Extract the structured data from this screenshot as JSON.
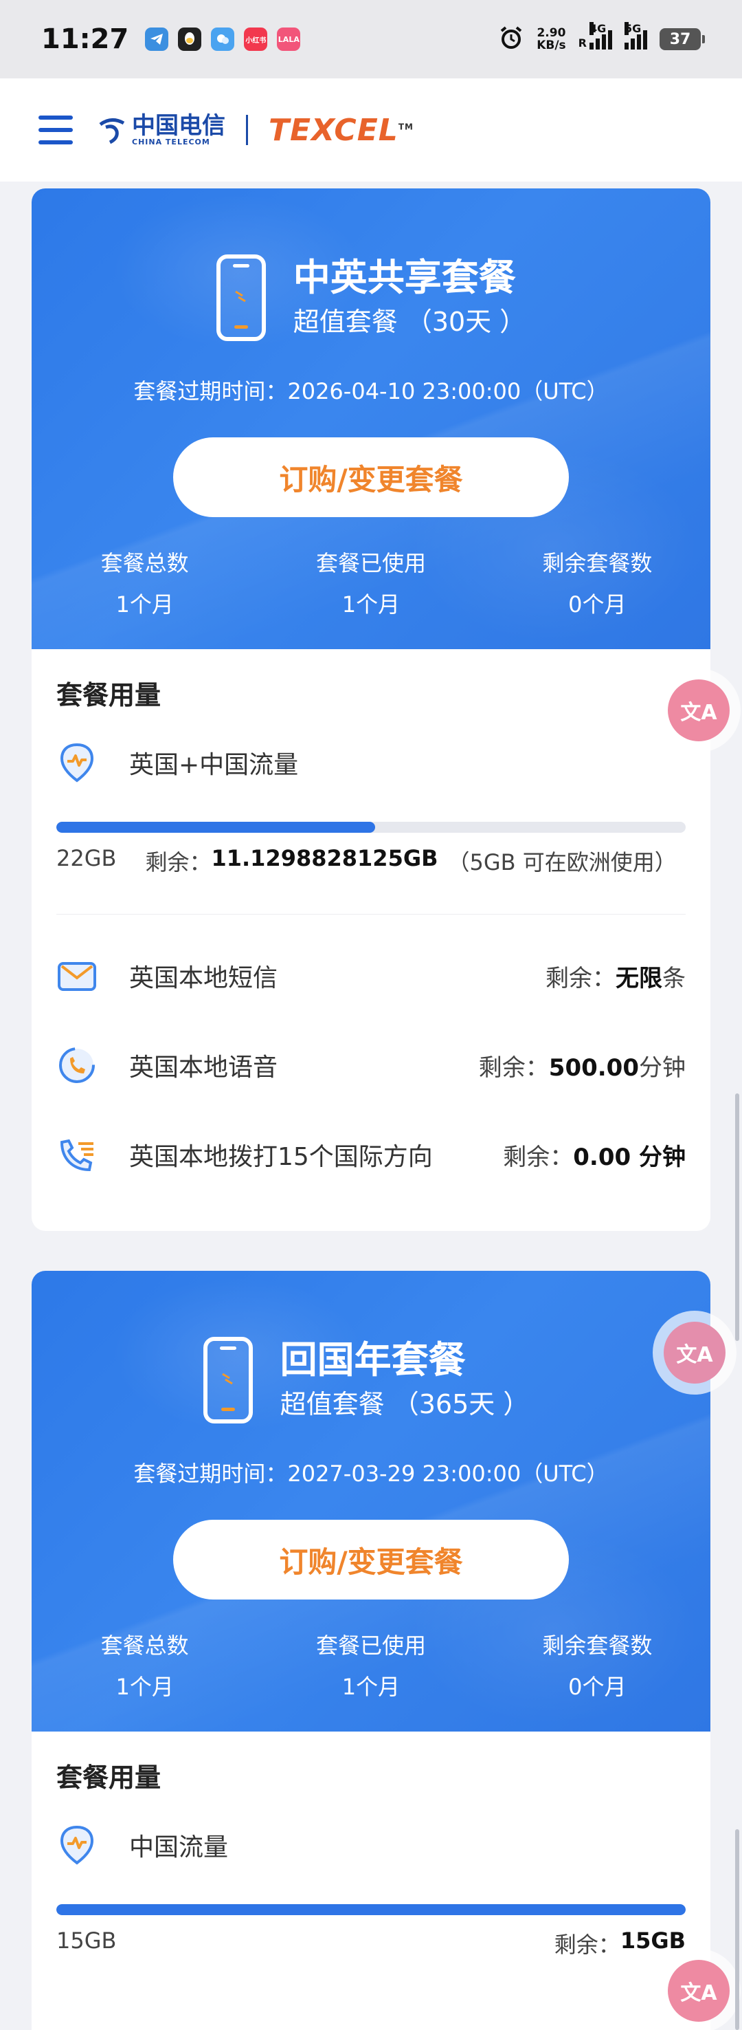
{
  "status_bar": {
    "time": "11:27",
    "net_speed_value": "2.90",
    "net_speed_unit": "KB/s",
    "net_r": "R",
    "sig1_label": "4G",
    "sig2_label": "5G",
    "battery": "37",
    "notif_label": "小红书",
    "notif_label2": "LALA"
  },
  "header": {
    "brand_cn": "中国电信",
    "brand_en": "CHINA TELECOM",
    "partner": "TEXCEL",
    "partner_tm": "TM"
  },
  "plans": [
    {
      "name": "中英共享套餐",
      "subtitle": "超值套餐 （30天 ）",
      "expire": "套餐过期时间：2026-04-10 23:00:00（UTC）",
      "order_button": "订购/变更套餐",
      "stats": [
        {
          "label": "套餐总数",
          "value": "1个月"
        },
        {
          "label": "套餐已使用",
          "value": "1个月"
        },
        {
          "label": "剩余套餐数",
          "value": "0个月"
        }
      ],
      "usage_title": "套餐用量",
      "data": {
        "label": "英国+中国流量",
        "progress_fraction": 0.507,
        "total": "22GB",
        "remain_prefix": "剩余：",
        "remain_value": "11.1298828125GB",
        "note": "（5GB 可在欧洲使用）"
      },
      "services": [
        {
          "label": "英国本地短信",
          "remain_prefix": "剩余：",
          "remain_value": "无限",
          "remain_unit": "条"
        },
        {
          "label": "英国本地语音",
          "remain_prefix": "剩余：",
          "remain_value": "500.00",
          "remain_unit": "分钟"
        },
        {
          "label": "英国本地拨打15个国际方向",
          "remain_prefix": "剩余：",
          "remain_value": "0.00",
          "remain_unit": " 分钟"
        }
      ]
    },
    {
      "name": "回国年套餐",
      "subtitle": "超值套餐 （365天 ）",
      "expire": "套餐过期时间：2027-03-29 23:00:00（UTC）",
      "order_button": "订购/变更套餐",
      "stats": [
        {
          "label": "套餐总数",
          "value": "1个月"
        },
        {
          "label": "套餐已使用",
          "value": "1个月"
        },
        {
          "label": "剩余套餐数",
          "value": "0个月"
        }
      ],
      "usage_title": "套餐用量",
      "data": {
        "label": "中国流量",
        "progress_fraction": 1.0,
        "total": "15GB",
        "remain_prefix": "剩余：",
        "remain_value": "15GB"
      }
    }
  ],
  "floating": {
    "translate_glyph": "文A"
  },
  "colors": {
    "brand_blue": "#2e74e6",
    "orange": "#f0852c",
    "pink": "#ee8aa2"
  }
}
